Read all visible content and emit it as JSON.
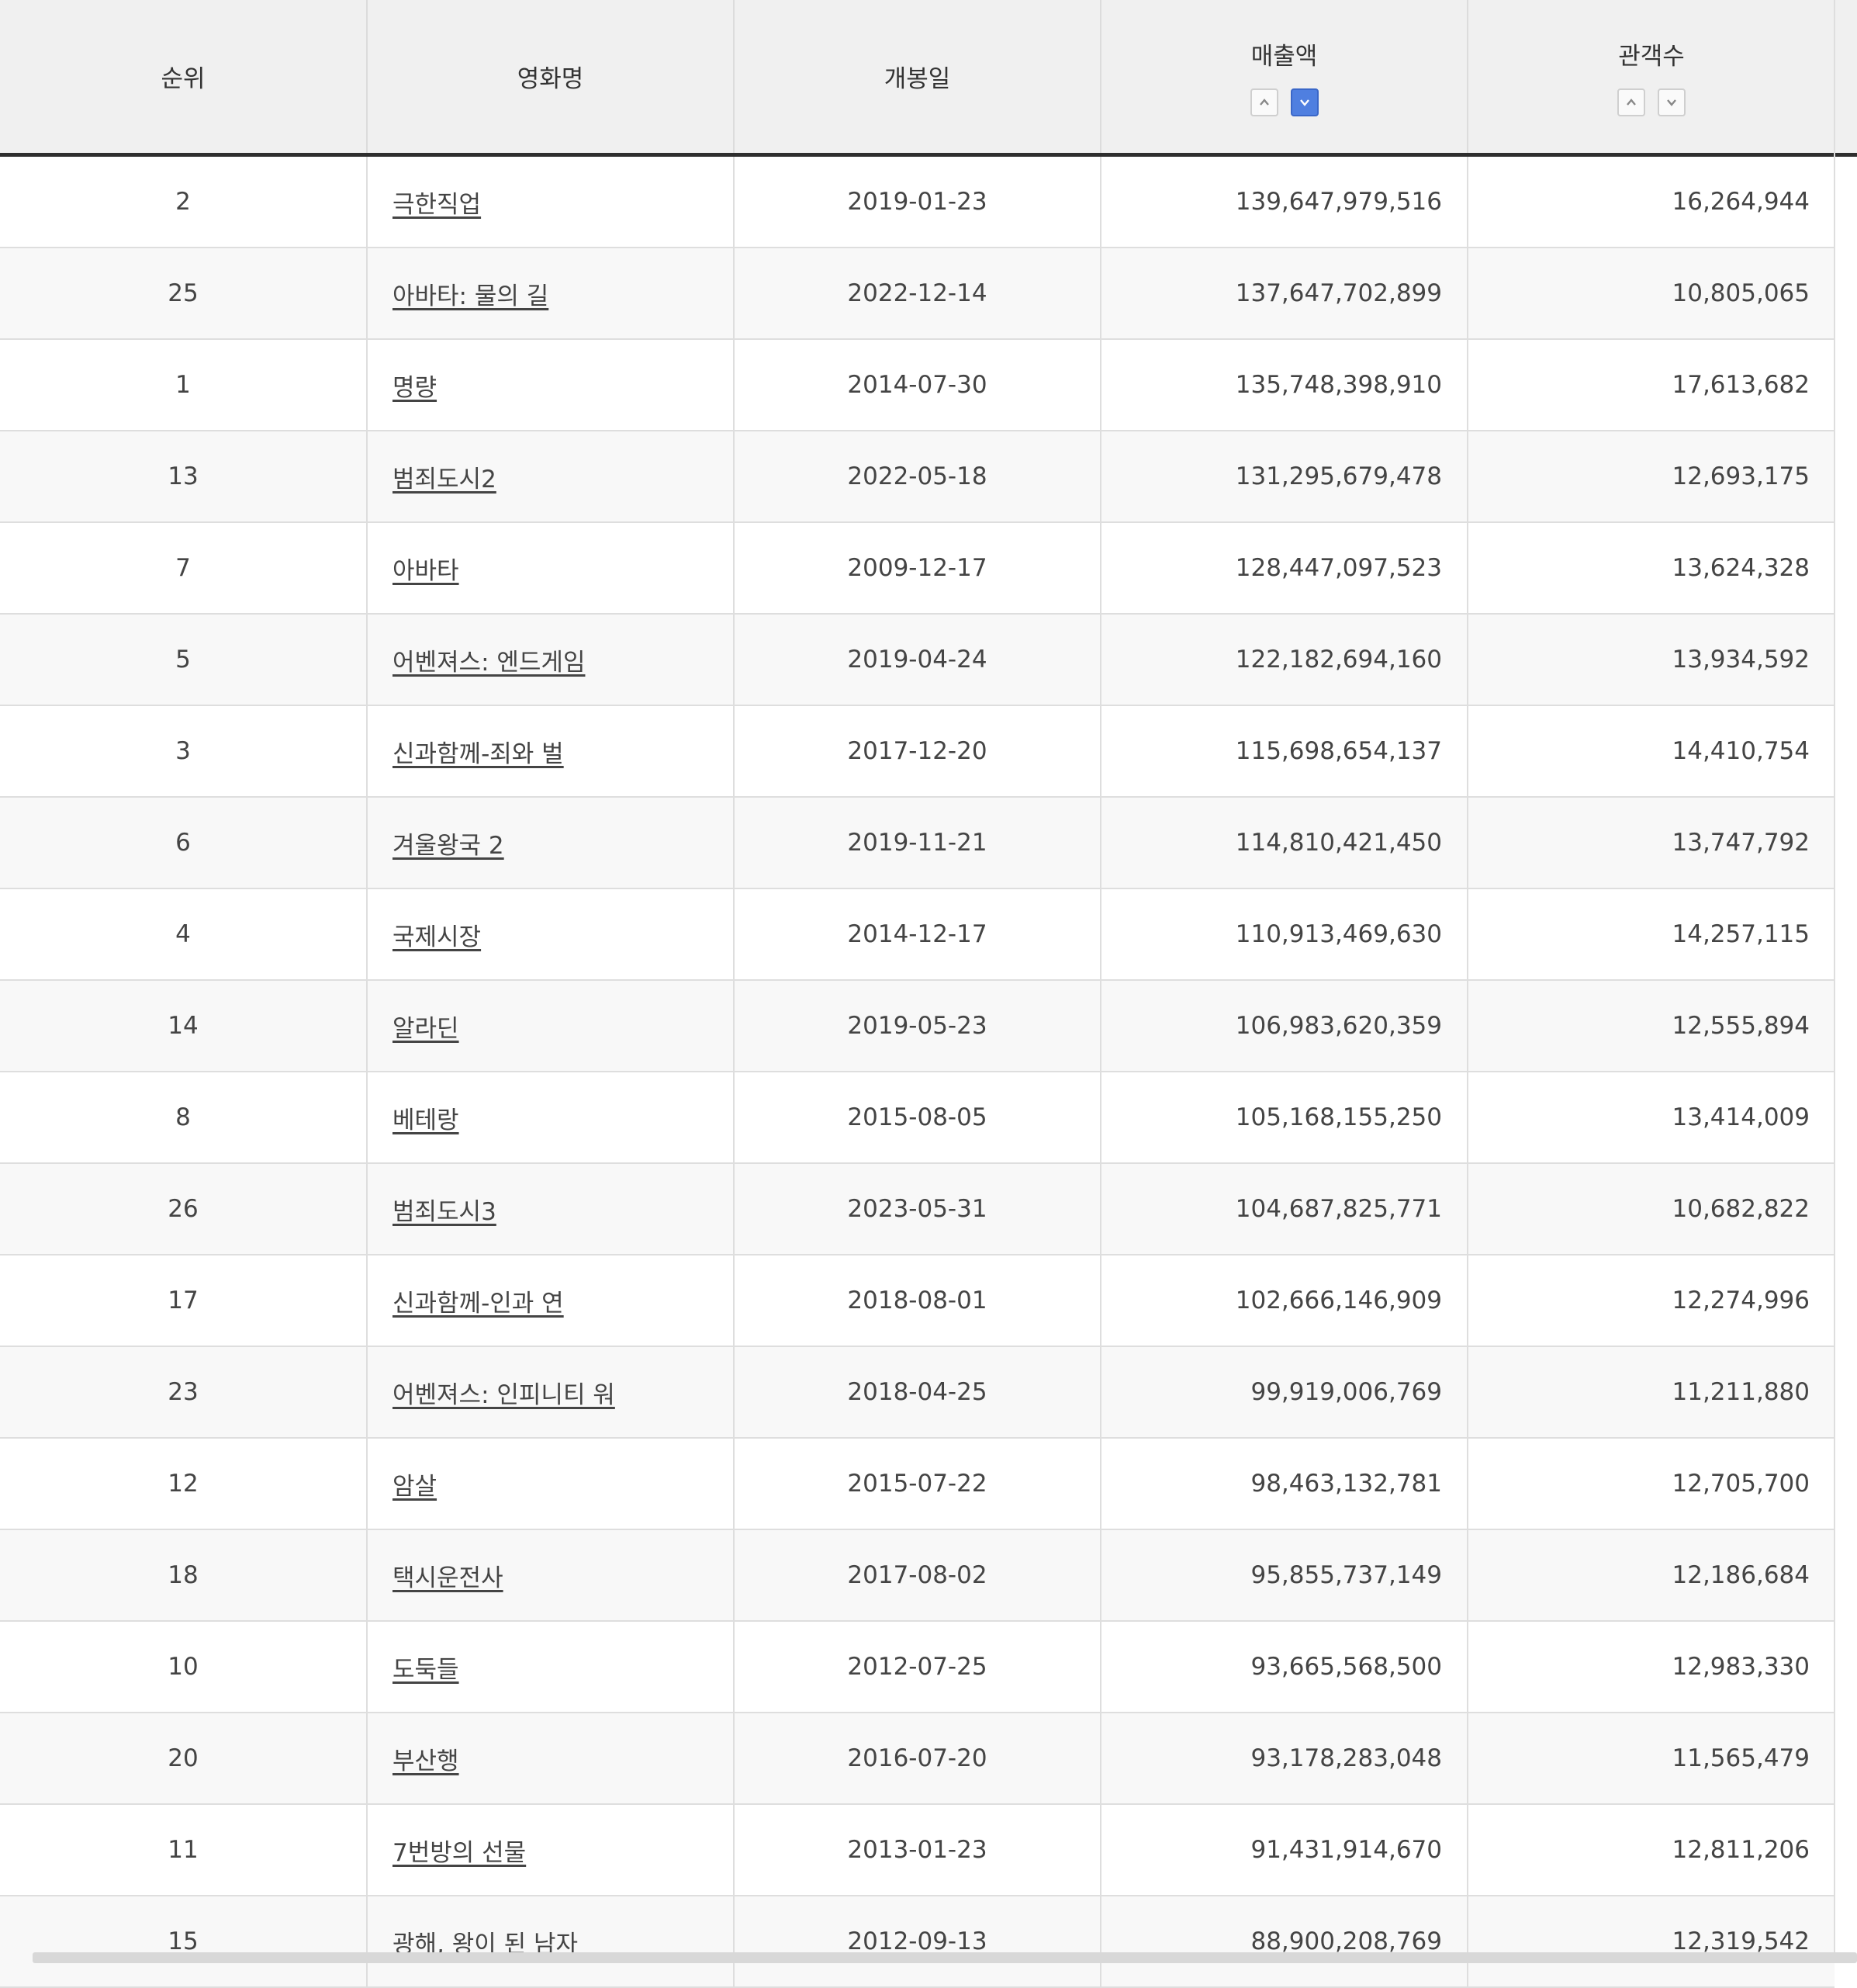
{
  "table": {
    "headers": {
      "rank": "순위",
      "title": "영화명",
      "release_date": "개봉일",
      "revenue": "매출액",
      "audience": "관객수"
    },
    "sort": {
      "up": "^",
      "down": "v",
      "active_column": "revenue",
      "active_direction": "desc"
    },
    "rows": [
      {
        "rank": "2",
        "title": "극한직업",
        "date": "2019-01-23",
        "revenue": "139,647,979,516",
        "audience": "16,264,944"
      },
      {
        "rank": "25",
        "title": "아바타: 물의 길",
        "date": "2022-12-14",
        "revenue": "137,647,702,899",
        "audience": "10,805,065"
      },
      {
        "rank": "1",
        "title": "명량",
        "date": "2014-07-30",
        "revenue": "135,748,398,910",
        "audience": "17,613,682"
      },
      {
        "rank": "13",
        "title": "범죄도시2",
        "date": "2022-05-18",
        "revenue": "131,295,679,478",
        "audience": "12,693,175"
      },
      {
        "rank": "7",
        "title": "아바타",
        "date": "2009-12-17",
        "revenue": "128,447,097,523",
        "audience": "13,624,328"
      },
      {
        "rank": "5",
        "title": "어벤져스: 엔드게임",
        "date": "2019-04-24",
        "revenue": "122,182,694,160",
        "audience": "13,934,592"
      },
      {
        "rank": "3",
        "title": "신과함께-죄와 벌",
        "date": "2017-12-20",
        "revenue": "115,698,654,137",
        "audience": "14,410,754"
      },
      {
        "rank": "6",
        "title": "겨울왕국 2",
        "date": "2019-11-21",
        "revenue": "114,810,421,450",
        "audience": "13,747,792"
      },
      {
        "rank": "4",
        "title": "국제시장",
        "date": "2014-12-17",
        "revenue": "110,913,469,630",
        "audience": "14,257,115"
      },
      {
        "rank": "14",
        "title": "알라딘",
        "date": "2019-05-23",
        "revenue": "106,983,620,359",
        "audience": "12,555,894"
      },
      {
        "rank": "8",
        "title": "베테랑",
        "date": "2015-08-05",
        "revenue": "105,168,155,250",
        "audience": "13,414,009"
      },
      {
        "rank": "26",
        "title": "범죄도시3",
        "date": "2023-05-31",
        "revenue": "104,687,825,771",
        "audience": "10,682,822"
      },
      {
        "rank": "17",
        "title": "신과함께-인과 연",
        "date": "2018-08-01",
        "revenue": "102,666,146,909",
        "audience": "12,274,996"
      },
      {
        "rank": "23",
        "title": "어벤져스: 인피니티 워",
        "date": "2018-04-25",
        "revenue": "99,919,006,769",
        "audience": "11,211,880"
      },
      {
        "rank": "12",
        "title": "암살",
        "date": "2015-07-22",
        "revenue": "98,463,132,781",
        "audience": "12,705,700"
      },
      {
        "rank": "18",
        "title": "택시운전사",
        "date": "2017-08-02",
        "revenue": "95,855,737,149",
        "audience": "12,186,684"
      },
      {
        "rank": "10",
        "title": "도둑들",
        "date": "2012-07-25",
        "revenue": "93,665,568,500",
        "audience": "12,983,330"
      },
      {
        "rank": "20",
        "title": "부산행",
        "date": "2016-07-20",
        "revenue": "93,178,283,048",
        "audience": "11,565,479"
      },
      {
        "rank": "11",
        "title": "7번방의 선물",
        "date": "2013-01-23",
        "revenue": "91,431,914,670",
        "audience": "12,811,206"
      },
      {
        "rank": "15",
        "title": "광해, 왕이 된 남자",
        "date": "2012-09-13",
        "revenue": "88,900,208,769",
        "audience": "12,319,542"
      }
    ]
  }
}
